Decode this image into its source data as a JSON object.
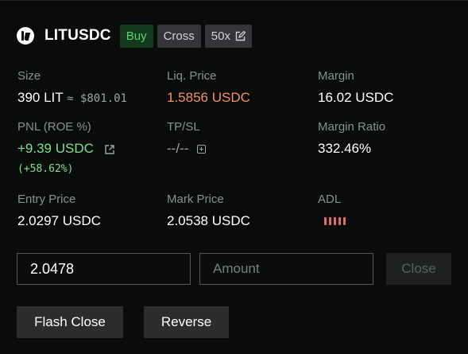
{
  "header": {
    "symbol": "LITUSDC",
    "side": "Buy",
    "margin_mode": "Cross",
    "leverage": "50x",
    "icons": [
      "lighter-logo-icon",
      "edit-icon"
    ]
  },
  "stats": {
    "size": {
      "label": "Size",
      "value": "390 LIT",
      "approx": "≈ $801.01"
    },
    "liq_price": {
      "label": "Liq. Price",
      "value": "1.5856 USDC"
    },
    "margin": {
      "label": "Margin",
      "value": "16.02 USDC"
    },
    "pnl": {
      "label": "PNL (ROE %)",
      "value": "+9.39 USDC",
      "roe": "(+58.62%)"
    },
    "tpsl": {
      "label": "TP/SL",
      "value": "--/--"
    },
    "margin_ratio": {
      "label": "Margin Ratio",
      "value": "332.46%"
    },
    "entry_price": {
      "label": "Entry Price",
      "value": "2.0297 USDC"
    },
    "mark_price": {
      "label": "Mark Price",
      "value": "2.0538 USDC"
    },
    "adl": {
      "label": "ADL",
      "level": 5,
      "max_level": 5
    }
  },
  "close_form": {
    "price_value": "2.0478",
    "amount_placeholder": "Amount",
    "close_label": "Close"
  },
  "actions": {
    "flash_close_label": "Flash Close",
    "reverse_label": "Reverse"
  },
  "colors": {
    "background": "#0a0c0b",
    "buy_green": "#56d66a",
    "pnl_green": "#7ee08a",
    "liq_orange": "#f0906a",
    "adl_red": "#e06a6a"
  }
}
